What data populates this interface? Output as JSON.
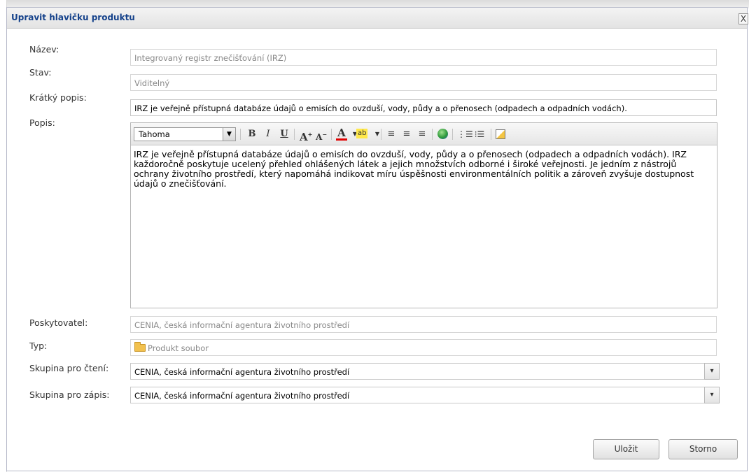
{
  "dialog": {
    "title": "Upravit hlavičku produktu",
    "close_label": "X"
  },
  "form": {
    "nazev": {
      "label": "Název:",
      "value": "Integrovaný registr znečišťování (IRZ)"
    },
    "stav": {
      "label": "Stav:",
      "value": "Viditelný"
    },
    "kratky_popis": {
      "label": "Krátký popis:",
      "value": "IRZ je veřejně přístupná databáze údajů o emisích do ovzduší, vody, půdy a o přenosech (odpadech a odpadních vodách)."
    },
    "popis": {
      "label": "Popis:",
      "value": "IRZ je veřejně přístupná databáze údajů o emisích do ovzduší, vody, půdy a o přenosech (odpadech a odpadních vodách). IRZ každoročně poskytuje ucelený přehled ohlášených látek a jejich množstvích odborné i široké veřejnosti. Je jedním z nástrojů ochrany životního prostředí, který napomáhá indikovat míru úspěšnosti environmentálních politik a zároveň zvyšuje dostupnost údajů o znečišťování."
    },
    "poskytovatel": {
      "label": "Poskytovatel:",
      "value": "CENIA, česká informační agentura životního prostředí"
    },
    "typ": {
      "label": "Typ:",
      "value": "Produkt soubor"
    },
    "skupina_cteni": {
      "label": "Skupina pro čtení:",
      "value": "CENIA, česká informační agentura životního prostředí"
    },
    "skupina_zapis": {
      "label": "Skupina pro zápis:",
      "value": "CENIA, česká informační agentura životního prostředí"
    }
  },
  "editor_toolbar": {
    "font": "Tahoma",
    "bold": "B",
    "italic": "I",
    "underline": "U",
    "grow_font": "A",
    "shrink_font": "A",
    "font_color": "A",
    "highlight": "ab"
  },
  "buttons": {
    "save": "Uložit",
    "cancel": "Storno"
  }
}
